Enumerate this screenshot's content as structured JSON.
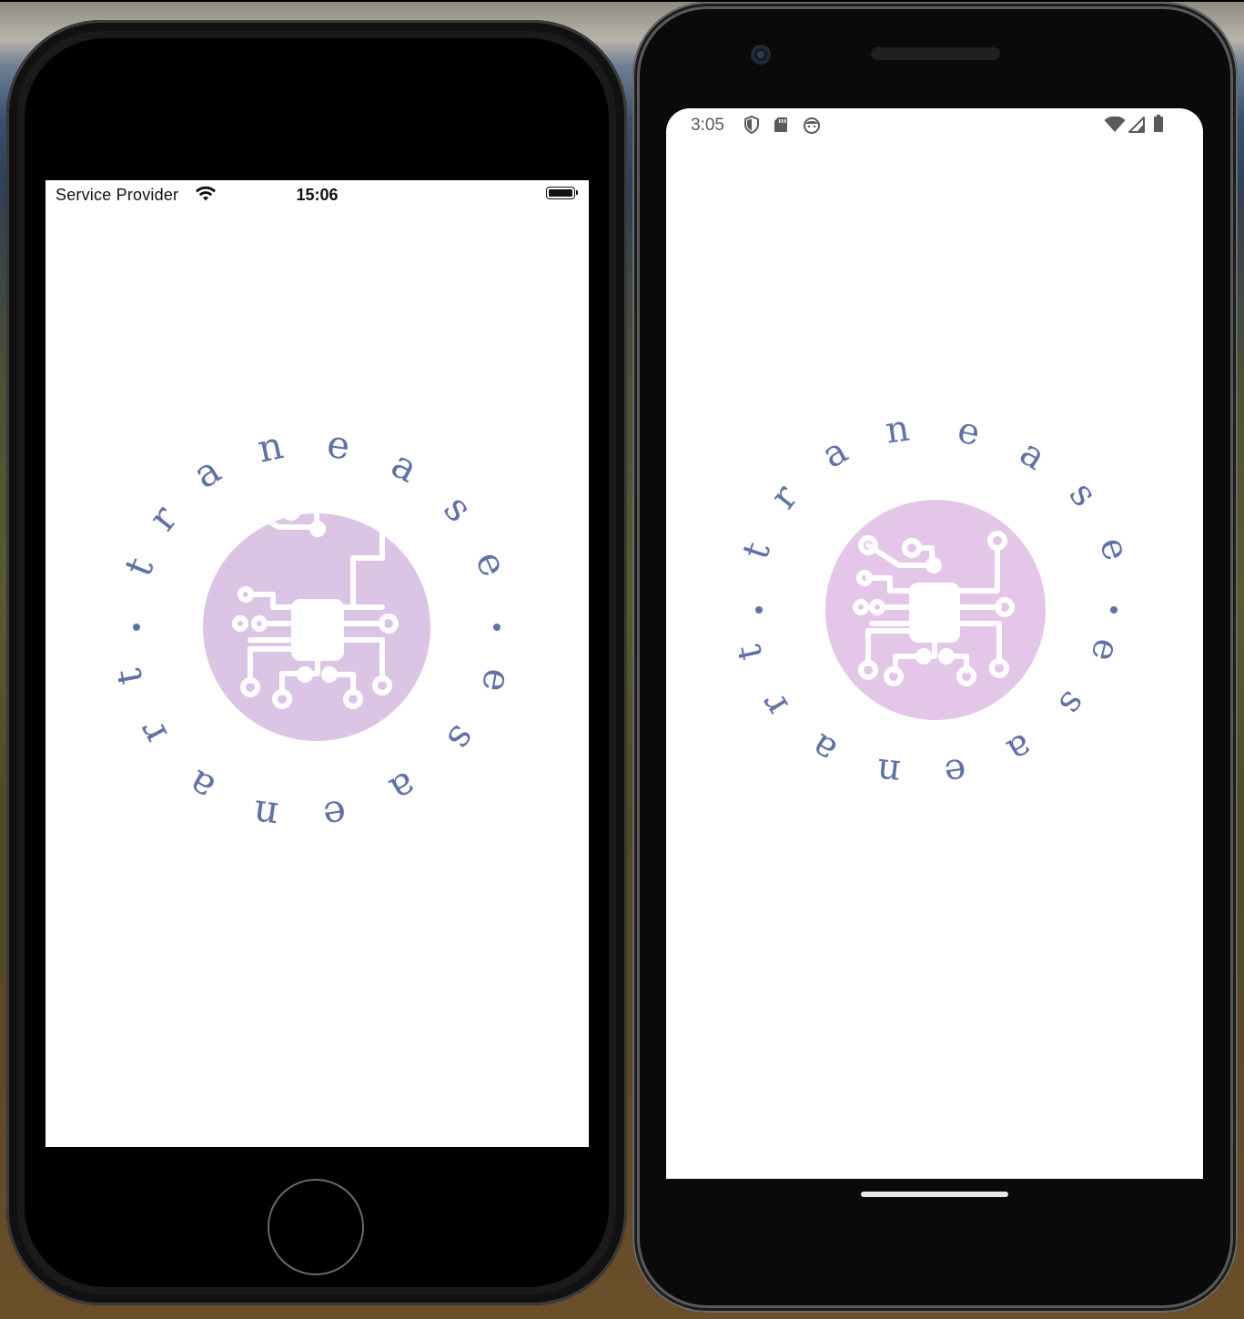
{
  "ios": {
    "carrier": "Service Provider",
    "time": "15:06"
  },
  "android": {
    "time": "3:05"
  },
  "logo": {
    "text": "traneaseXtranease",
    "brand": "traneaseXtranease",
    "text_color": "#5f72a8",
    "circle_color": "#dcc5e4",
    "android_circle_color": "#e3c6e8",
    "icon": "circuit-chip-icon"
  }
}
